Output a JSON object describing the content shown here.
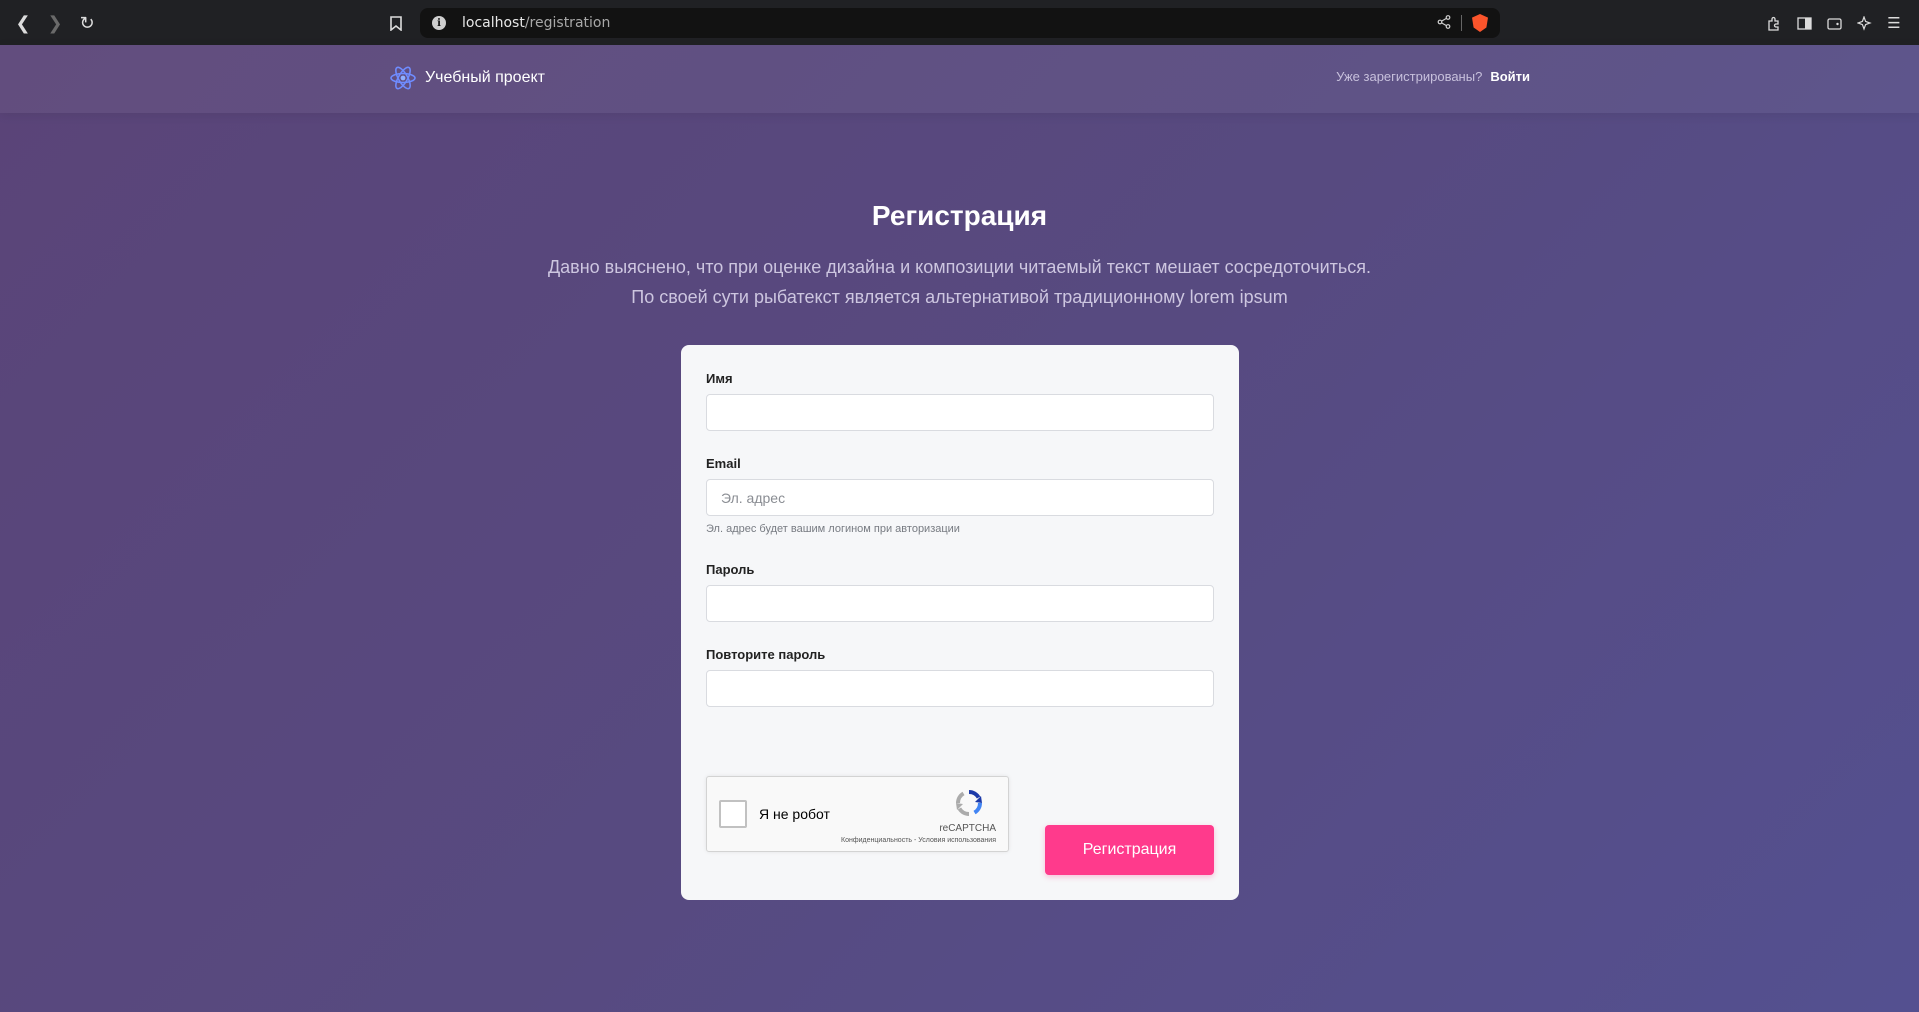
{
  "browser": {
    "url_host": "localhost",
    "url_path": "/registration"
  },
  "header": {
    "brand_name": "Учебный проект",
    "question": "Уже зарегистрированы?",
    "login_link": "Войти"
  },
  "hero": {
    "title": "Регистрация",
    "desc_line1": "Давно выяснено, что при оценке дизайна и композиции читаемый текст мешает сосредоточиться.",
    "desc_line2": "По своей сути рыбатекст является альтернативой традиционному lorem ipsum"
  },
  "form": {
    "name": {
      "label": "Имя",
      "value": "",
      "placeholder": ""
    },
    "email": {
      "label": "Email",
      "value": "",
      "placeholder": "Эл. адрес",
      "hint": "Эл. адрес будет вашим логином при авторизации"
    },
    "password": {
      "label": "Пароль",
      "value": "",
      "placeholder": ""
    },
    "password_repeat": {
      "label": "Повторите пароль",
      "value": "",
      "placeholder": ""
    },
    "captcha": {
      "label": "Я не робот",
      "brand": "reCAPTCHA",
      "privacy": "Конфиденциальность",
      "separator": " - ",
      "terms": "Условия использования",
      "checked": false
    },
    "submit_label": "Регистрация"
  },
  "colors": {
    "accent": "#ff3a8c",
    "background": "#574a80"
  }
}
